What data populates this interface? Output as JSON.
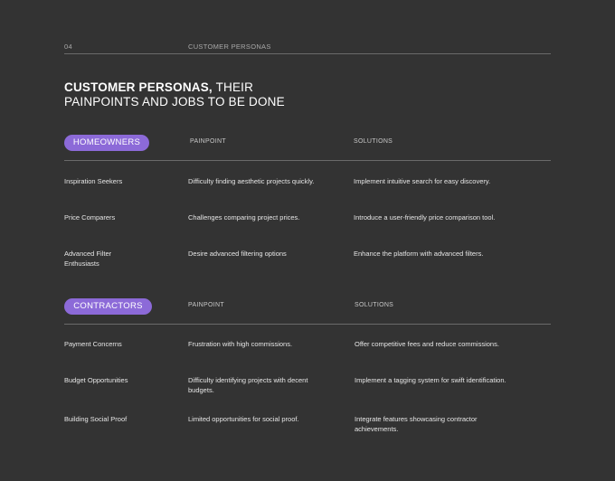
{
  "header": {
    "page_number": "04",
    "section_label": "CUSTOMER PERSONAS"
  },
  "title": {
    "bold": "CUSTOMER PERSONAS,",
    "rest_line1": " THEIR",
    "line2": "PAINPOINTS AND JOBS TO BE DONE"
  },
  "accent_color": "#8c6ad8",
  "homeowners": {
    "label": "HOMEOWNERS",
    "col_painpoint": "PAINPOINT",
    "col_solutions": "SOLUTIONS",
    "rows": [
      {
        "persona": "Inspiration Seekers",
        "painpoint": "Difficulty finding aesthetic projects quickly.",
        "solution": "Implement intuitive search for easy discovery."
      },
      {
        "persona": "Price Comparers",
        "painpoint": "Challenges comparing project prices.",
        "solution": "Introduce a user-friendly price comparison tool."
      },
      {
        "persona": "Advanced Filter Enthusiasts",
        "painpoint": "Desire advanced filtering options",
        "solution": "Enhance the platform with advanced filters."
      }
    ]
  },
  "contractors": {
    "label": "CONTRACTORS",
    "col_painpoint": "PAINPOINT",
    "col_solutions": "SOLUTIONS",
    "rows": [
      {
        "persona": "Payment Concerns",
        "painpoint": "Frustration with high commissions.",
        "solution": "Offer competitive fees and reduce commissions."
      },
      {
        "persona": "Budget Opportunities",
        "painpoint": "Difficulty identifying projects with decent budgets.",
        "solution": "Implement a tagging system for swift identification."
      },
      {
        "persona": "Building Social Proof",
        "painpoint": "Limited opportunities for social proof.",
        "solution": "Integrate features showcasing contractor achievements."
      }
    ]
  }
}
